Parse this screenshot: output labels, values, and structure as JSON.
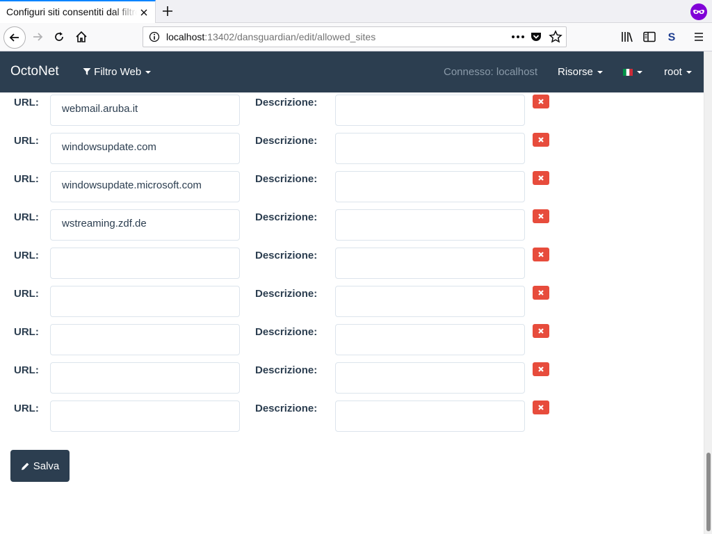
{
  "browser": {
    "tab_title": "Configuri siti consentiti dal filtro web",
    "url_host": "localhost",
    "url_rest": ":13402/dansguardian/edit/allowed_sites"
  },
  "app": {
    "brand": "OctoNet",
    "menu_filter": "Filtro Web",
    "connected": "Connesso: localhost",
    "menu_resources": "Risorse",
    "menu_user": "root"
  },
  "labels": {
    "url": "URL:",
    "description": "Descrizione:"
  },
  "rows": [
    {
      "url": "webmail.aruba.it",
      "description": ""
    },
    {
      "url": "windowsupdate.com",
      "description": ""
    },
    {
      "url": "windowsupdate.microsoft.com",
      "description": ""
    },
    {
      "url": "wstreaming.zdf.de",
      "description": ""
    },
    {
      "url": "",
      "description": ""
    },
    {
      "url": "",
      "description": ""
    },
    {
      "url": "",
      "description": ""
    },
    {
      "url": "",
      "description": ""
    },
    {
      "url": "",
      "description": ""
    }
  ],
  "save_label": "Salva",
  "colors": {
    "navbar": "#2c3e50",
    "danger": "#e74c3c",
    "text": "#2c3e50",
    "private_browsing": "#8000d7"
  },
  "icons": {
    "filter": "filter-icon",
    "pencil": "pencil-icon",
    "delete": "times-icon"
  }
}
